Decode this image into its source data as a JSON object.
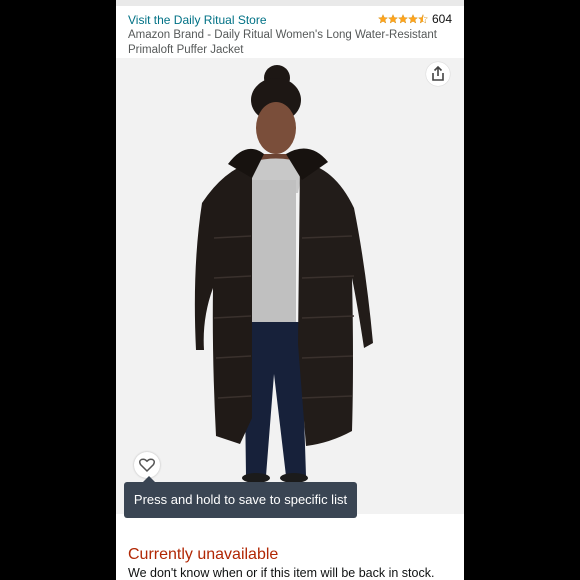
{
  "store": {
    "link_label": "Visit the Daily Ritual Store"
  },
  "rating": {
    "stars": 4.5,
    "count": "604"
  },
  "product": {
    "title": "Amazon Brand - Daily Ritual Women's Long Water-Resistant Primaloft Puffer Jacket"
  },
  "actions": {
    "share_icon": "share-icon",
    "heart_icon": "heart-icon"
  },
  "tooltip": {
    "text": "Press and hold to save to specific list"
  },
  "availability": {
    "status": "Currently unavailable",
    "note": "We don't know when or if this item will be back in stock."
  },
  "colors": {
    "link": "#007185",
    "star": "#ffa41c",
    "unavailable": "#b12704",
    "tooltip_bg": "#3a4553"
  }
}
